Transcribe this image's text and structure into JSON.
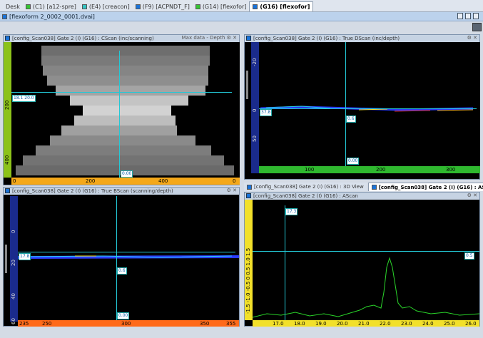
{
  "tabs": [
    {
      "label": "Desk",
      "color": ""
    },
    {
      "label": "(C1) [a12-spre]",
      "color": "#35c435"
    },
    {
      "label": "(E4) [creacon]",
      "color": "#35c4c4"
    },
    {
      "label": "(F9) [ACPNDT_F]",
      "color": "#1a73d9"
    },
    {
      "label": "(G14) [flexofor]",
      "color": "#35c435"
    },
    {
      "label": "(G16) [flexofor]",
      "color": "#1a73d9"
    }
  ],
  "document_title": "[flexoform 2_0002_0001.dvai]",
  "panels": {
    "cscan": {
      "title": "[config_Scan038] Gate 2 (I) (G16) : CScan (inc/scanning)",
      "right": "Max data - Depth",
      "xticks": [
        "0",
        "200",
        "400",
        "0"
      ],
      "yticks": [
        "200",
        "400"
      ],
      "labels": {
        "h": "18.1 20.0",
        "v": "0.00"
      }
    },
    "dscan": {
      "title": "[config_Scan038] Gate 2 (I) (G16) : True DScan (inc/depth)",
      "xticks": [
        "100",
        "200",
        "300"
      ],
      "yticks": [
        "-20",
        "0",
        "50"
      ],
      "labels": {
        "h": "37.8",
        "p": "0.6",
        "v": "0.00"
      }
    },
    "bscan": {
      "title": "[config_Scan038] Gate 2 (I) (G16) : True BScan (scanning/depth)",
      "xticks": [
        "235",
        "250",
        "300",
        "350",
        "355"
      ],
      "yticks": [
        "0",
        "20",
        "40",
        "60"
      ],
      "labels": {
        "h": "17.8",
        "p": "0.6",
        "v": "0.00"
      }
    },
    "view3d": {
      "tab": "[config_Scan038] Gate 2 (I) (G16) : 3D View"
    },
    "ascan_tab": {
      "tab": "[config_Scan038] Gate 2 (I) (G16) : AScan"
    },
    "ascan": {
      "title": "[config_Scan038] Gate 2 (I) (G16) : AScan",
      "xticks": [
        "17.0",
        "18.0",
        "19.0",
        "20.0",
        "21.0",
        "22.0",
        "23.0",
        "24.0",
        "25.0",
        "26.0"
      ],
      "ylabel": "-1.5 -1.0 -0.5 0 0.5 1.0 1.5",
      "labels": {
        "v": "17.3",
        "h": "0.5"
      }
    }
  },
  "icons": {
    "tab": "tab-color-swatch",
    "panel": "scan-view-icon",
    "tool": "settings-icon"
  }
}
